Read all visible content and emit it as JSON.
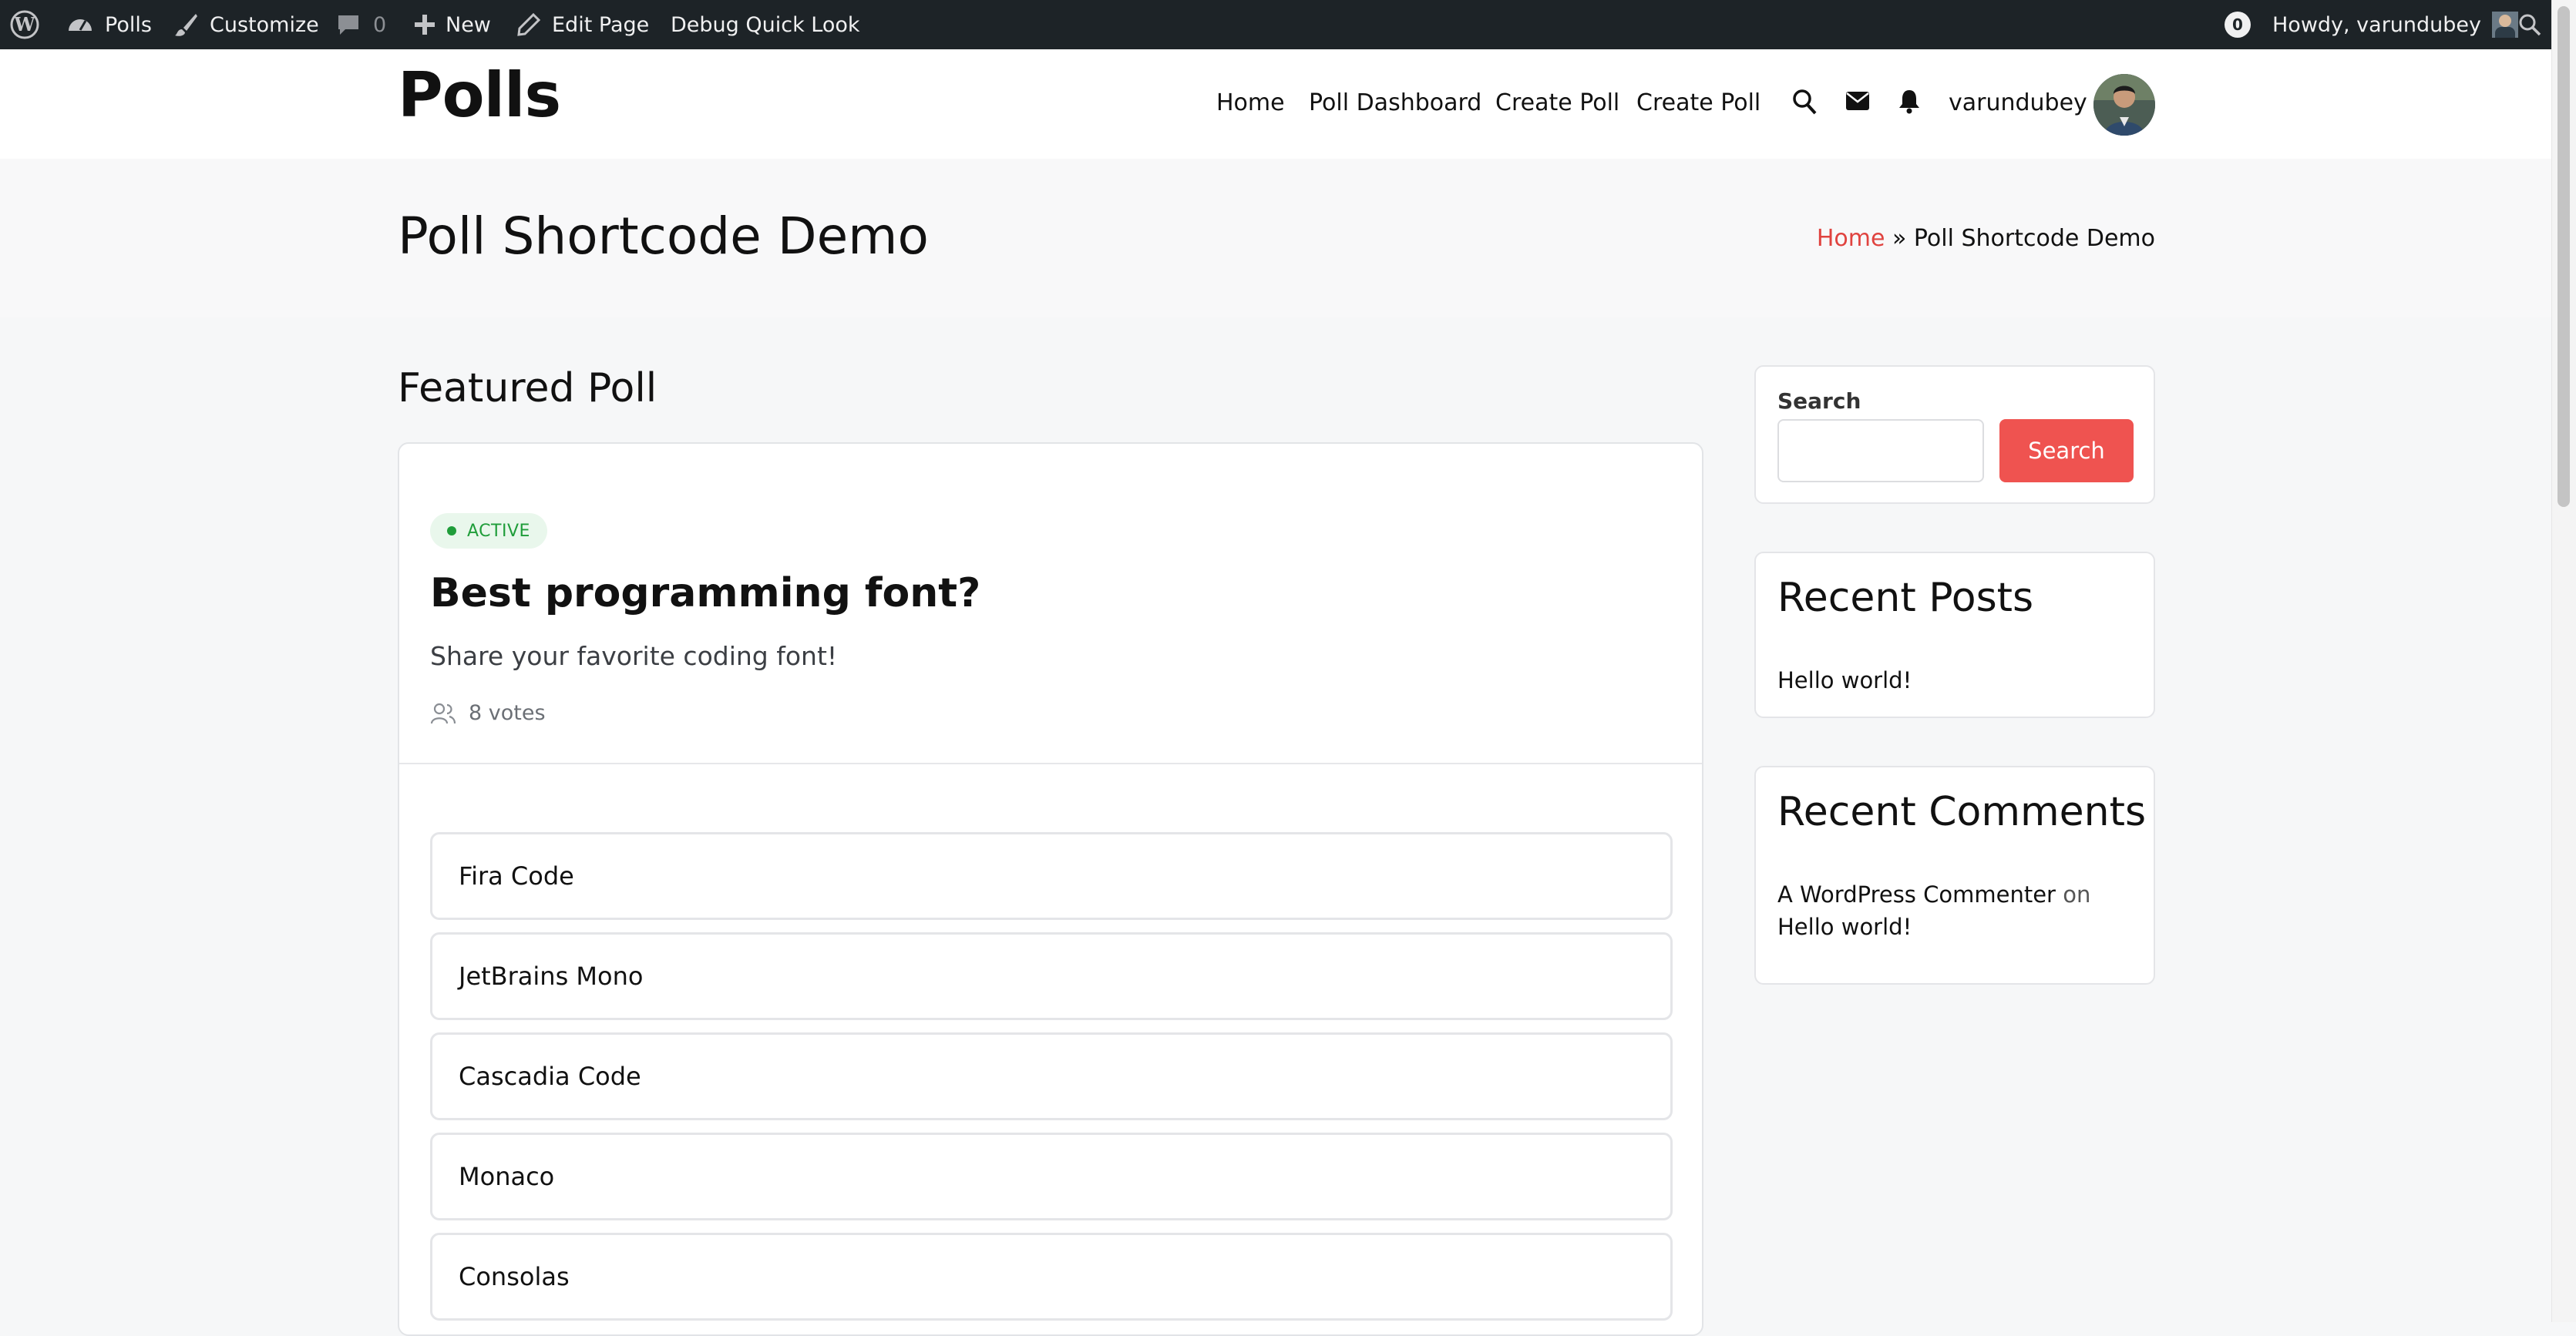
{
  "admin_bar": {
    "site_name": "Polls",
    "customize": "Customize",
    "comments_count": "0",
    "new": "New",
    "edit_page": "Edit Page",
    "debug": "Debug Quick Look",
    "notifications": "0",
    "howdy": "Howdy, varundubey"
  },
  "header": {
    "site_title": "Polls",
    "nav": [
      "Home",
      "Poll Dashboard",
      "Create Poll",
      "Create Poll"
    ],
    "username": "varundubey"
  },
  "page": {
    "title": "Poll Shortcode Demo",
    "breadcrumb_home": "Home",
    "breadcrumb_sep": "»",
    "breadcrumb_current": "Poll Shortcode Demo"
  },
  "main": {
    "section_heading": "Featured Poll",
    "poll": {
      "status": "ACTIVE",
      "question": "Best programming font?",
      "description": "Share your favorite coding font!",
      "votes": "8 votes",
      "options": [
        "Fira Code",
        "JetBrains Mono",
        "Cascadia Code",
        "Monaco",
        "Consolas"
      ]
    }
  },
  "sidebar": {
    "search_label": "Search",
    "search_button": "Search",
    "search_placeholder": "",
    "recent_posts_title": "Recent Posts",
    "recent_posts": [
      "Hello world!"
    ],
    "recent_comments_title": "Recent Comments",
    "comment_author": "A WordPress Commenter",
    "comment_on": "on",
    "comment_post": "Hello world!"
  },
  "colors": {
    "admin_bar": "#1d2327",
    "accent": "#ef5350",
    "breadcrumb_link": "#e0433f",
    "badge_green": "#1f9d3a"
  }
}
